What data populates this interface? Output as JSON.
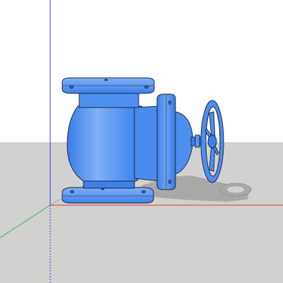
{
  "scene": {
    "model": "angle-valve",
    "colors": {
      "sky": "#ffffff",
      "ground": "#d1d1cf",
      "body": "#4d8ff0",
      "body_light": "#7fb0f7",
      "body_dark": "#2f6fd0",
      "outline": "#1b2a44",
      "shadow": "#a8a8a6",
      "axis_blue": "#3d3df0",
      "axis_red": "#e03a3a",
      "axis_green": "#34b34a"
    },
    "axes": {
      "blue": "vertical-axis",
      "red": "horizontal-axis",
      "green": "depth-axis"
    }
  }
}
